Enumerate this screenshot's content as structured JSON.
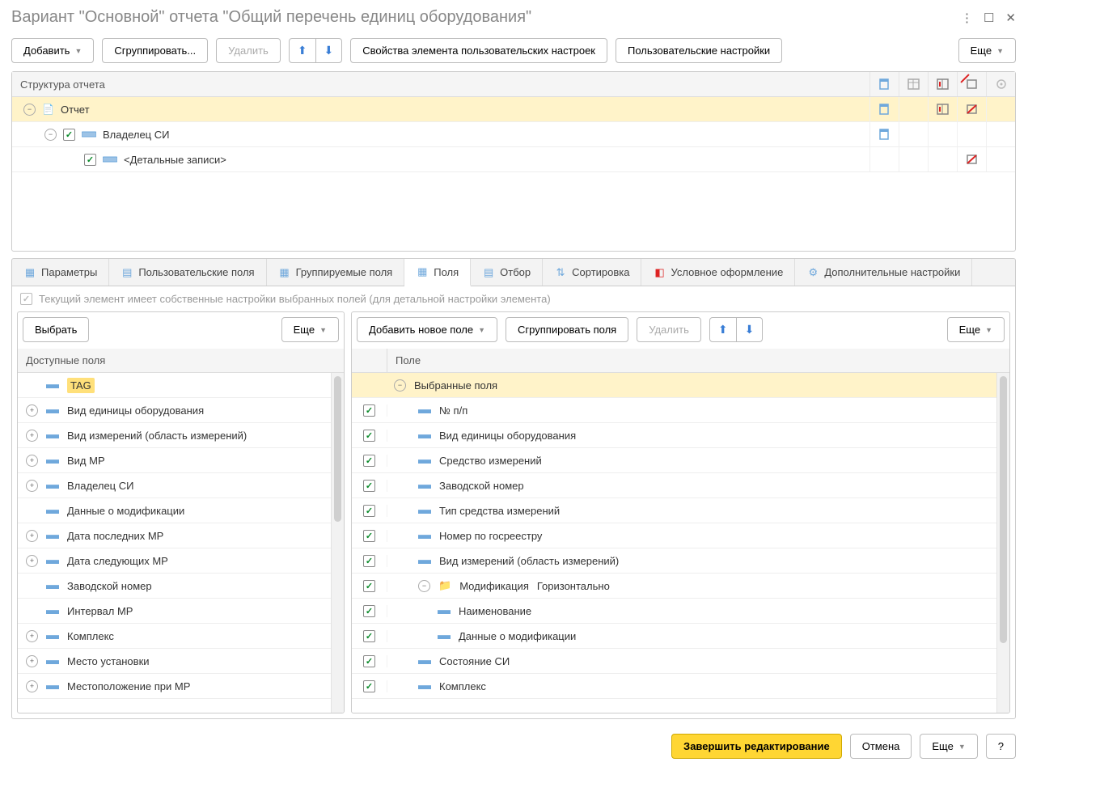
{
  "title": "Вариант \"Основной\" отчета \"Общий перечень единиц оборудования\"",
  "toolbar": {
    "add": "Добавить",
    "group": "Сгруппировать...",
    "delete": "Удалить",
    "props": "Свойства элемента пользовательских настроек",
    "userSettings": "Пользовательские настройки",
    "more": "Еще"
  },
  "structure": {
    "title": "Структура отчета",
    "rows": [
      {
        "label": "Отчет",
        "level": 0,
        "sel": true,
        "check": false,
        "icon": "doc",
        "icons": [
          true,
          false,
          true,
          true,
          false
        ]
      },
      {
        "label": "Владелец СИ",
        "level": 1,
        "sel": false,
        "check": true,
        "icon": "grp",
        "icons": [
          true,
          false,
          false,
          false,
          false
        ]
      },
      {
        "label": "<Детальные записи>",
        "level": 2,
        "sel": false,
        "check": true,
        "icon": "grp",
        "icons": [
          false,
          false,
          false,
          true,
          false
        ]
      }
    ]
  },
  "tabs": [
    "Параметры",
    "Пользовательские поля",
    "Группируемые поля",
    "Поля",
    "Отбор",
    "Сортировка",
    "Условное оформление",
    "Дополнительные настройки"
  ],
  "activeTab": 3,
  "hint": "Текущий элемент имеет собственные настройки выбранных полей (для детальной настройки элемента)",
  "leftToolbar": {
    "select": "Выбрать",
    "more": "Еще"
  },
  "rightToolbar": {
    "addNew": "Добавить новое поле",
    "groupFields": "Сгруппировать поля",
    "delete": "Удалить",
    "more": "Еще"
  },
  "leftCol": {
    "title": "Доступные поля",
    "items": [
      {
        "label": "TAG",
        "expand": null,
        "highlight": true
      },
      {
        "label": "Вид единицы оборудования",
        "expand": true
      },
      {
        "label": "Вид измерений (область измерений)",
        "expand": true
      },
      {
        "label": "Вид МР",
        "expand": true
      },
      {
        "label": "Владелец СИ",
        "expand": true
      },
      {
        "label": "Данные о модификации",
        "expand": null
      },
      {
        "label": "Дата последних МР",
        "expand": true
      },
      {
        "label": "Дата следующих МР",
        "expand": true
      },
      {
        "label": "Заводской номер",
        "expand": null
      },
      {
        "label": "Интервал МР",
        "expand": null
      },
      {
        "label": "Комплекс",
        "expand": true
      },
      {
        "label": "Место установки",
        "expand": true
      },
      {
        "label": "Местоположение при МР",
        "expand": true
      }
    ]
  },
  "rightCol": {
    "title": "Поле",
    "groupLabel": "Выбранные поля",
    "items": [
      {
        "label": "№ п/п",
        "level": 1
      },
      {
        "label": "Вид единицы оборудования",
        "level": 1
      },
      {
        "label": "Средство измерений",
        "level": 1
      },
      {
        "label": "Заводской номер",
        "level": 1
      },
      {
        "label": "Тип средства измерений",
        "level": 1
      },
      {
        "label": "Номер по госреестру",
        "level": 1
      },
      {
        "label": "Вид измерений (область измерений)",
        "level": 1
      },
      {
        "label": "Модификация",
        "level": 1,
        "folder": true,
        "extra": "Горизонтально"
      },
      {
        "label": "Наименование",
        "level": 2
      },
      {
        "label": "Данные о модификации",
        "level": 2
      },
      {
        "label": "Состояние СИ",
        "level": 1
      },
      {
        "label": "Комплекс",
        "level": 1
      }
    ]
  },
  "footer": {
    "finish": "Завершить редактирование",
    "cancel": "Отмена",
    "more": "Еще",
    "help": "?"
  }
}
